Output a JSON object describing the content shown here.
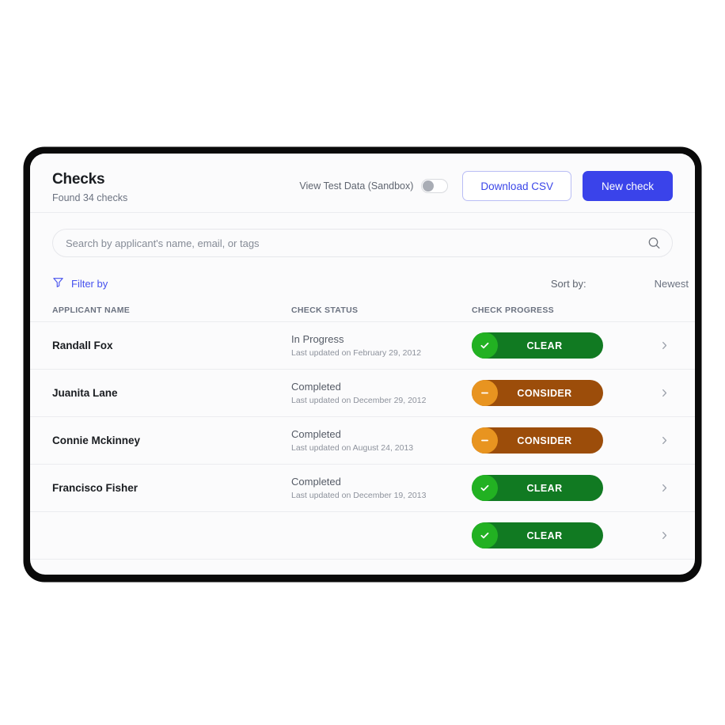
{
  "header": {
    "title": "Checks",
    "subtitle": "Found 34 checks",
    "toggle_label": "View Test Data (Sandbox)",
    "toggle_state": "off",
    "download_csv_label": "Download CSV",
    "new_check_label": "New check"
  },
  "search": {
    "placeholder": "Search by applicant's name, email, or tags",
    "value": "",
    "icon": "search-icon"
  },
  "filters": {
    "filter_label": "Filter by",
    "filter_icon": "funnel-icon",
    "sort_label": "Sort by:",
    "sort_value": "Newest"
  },
  "table": {
    "columns": [
      "APPLICANT NAME",
      "CHECK STATUS",
      "CHECK PROGRESS"
    ],
    "rows": [
      {
        "name": "Randall Fox",
        "status": "In Progress",
        "updated": "Last updated on February 29, 2012",
        "progress": "CLEAR",
        "progress_type": "clear",
        "progress_icon": "check-icon"
      },
      {
        "name": "Juanita Lane",
        "status": "Completed",
        "updated": "Last updated on December 29, 2012",
        "progress": "CONSIDER",
        "progress_type": "consider",
        "progress_icon": "minus-icon"
      },
      {
        "name": "Connie Mckinney",
        "status": "Completed",
        "updated": "Last updated on August 24, 2013",
        "progress": "CONSIDER",
        "progress_type": "consider",
        "progress_icon": "minus-icon"
      },
      {
        "name": "Francisco Fisher",
        "status": "Completed",
        "updated": "Last updated on December 19, 2013",
        "progress": "CLEAR",
        "progress_type": "clear",
        "progress_icon": "check-icon"
      },
      {
        "name": "",
        "status": "",
        "updated": "",
        "progress": "CLEAR",
        "progress_type": "clear",
        "progress_icon": "check-icon"
      }
    ]
  },
  "colors": {
    "primary": "#3a43ea",
    "primary_soft": "#b9bdf5",
    "clear_pill": "#117a22",
    "clear_badge": "#22b122",
    "consider_pill": "#9c4d0a",
    "consider_badge": "#e89420",
    "frame": "#0a0a0a",
    "card_bg": "#fbfbfc"
  }
}
